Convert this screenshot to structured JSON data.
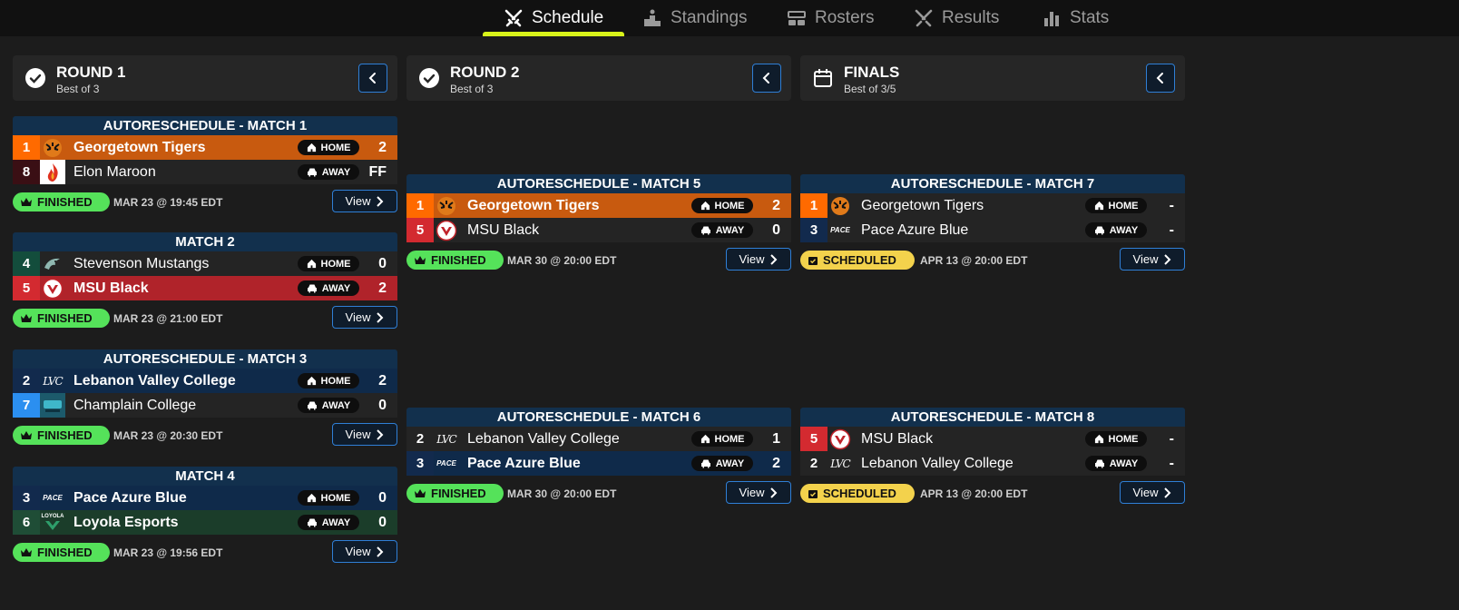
{
  "nav": {
    "tabs": [
      {
        "label": "Schedule",
        "icon": "crossed-swords-icon",
        "active": true
      },
      {
        "label": "Standings",
        "icon": "podium-icon",
        "active": false
      },
      {
        "label": "Rosters",
        "icon": "roster-icon",
        "active": false
      },
      {
        "label": "Results",
        "icon": "crossed-swords-icon",
        "active": false
      },
      {
        "label": "Stats",
        "icon": "bar-chart-icon",
        "active": false
      }
    ]
  },
  "rounds": [
    {
      "title": "ROUND 1",
      "subtitle": "Best of 3",
      "icon": "check-circle-icon"
    },
    {
      "title": "ROUND 2",
      "subtitle": "Best of 3",
      "icon": "check-circle-icon"
    },
    {
      "title": "FINALS",
      "subtitle": "Best of 3/5",
      "icon": "calendar-icon"
    }
  ],
  "labels": {
    "home": "HOME",
    "away": "AWAY",
    "view": "View",
    "finished": "FINISHED",
    "scheduled": "SCHEDULED"
  },
  "matches": {
    "m1": {
      "title": "AUTORESCHEDULE - MATCH 1",
      "home": {
        "seed": "1",
        "name": "Georgetown Tigers",
        "score": "2"
      },
      "away": {
        "seed": "8",
        "name": "Elon Maroon",
        "score": "FF"
      },
      "status": "FINISHED",
      "date": "MAR 23 @ 19:45 EDT"
    },
    "m2": {
      "title": "MATCH 2",
      "home": {
        "seed": "4",
        "name": "Stevenson Mustangs",
        "score": "0"
      },
      "away": {
        "seed": "5",
        "name": "MSU Black",
        "score": "2"
      },
      "status": "FINISHED",
      "date": "MAR 23 @ 21:00 EDT"
    },
    "m3": {
      "title": "AUTORESCHEDULE - MATCH 3",
      "home": {
        "seed": "2",
        "name": "Lebanon Valley College",
        "score": "2"
      },
      "away": {
        "seed": "7",
        "name": "Champlain College",
        "score": "0"
      },
      "status": "FINISHED",
      "date": "MAR 23 @ 20:30 EDT"
    },
    "m4": {
      "title": "MATCH 4",
      "home": {
        "seed": "3",
        "name": "Pace Azure Blue",
        "score": "0"
      },
      "away": {
        "seed": "6",
        "name": "Loyola Esports",
        "score": "0"
      },
      "status": "FINISHED",
      "date": "MAR 23 @ 19:56 EDT"
    },
    "m5": {
      "title": "AUTORESCHEDULE - MATCH 5",
      "home": {
        "seed": "1",
        "name": "Georgetown Tigers",
        "score": "2"
      },
      "away": {
        "seed": "5",
        "name": "MSU Black",
        "score": "0"
      },
      "status": "FINISHED",
      "date": "MAR 30 @ 20:00 EDT"
    },
    "m6": {
      "title": "AUTORESCHEDULE - MATCH 6",
      "home": {
        "seed": "2",
        "name": "Lebanon Valley College",
        "score": "1"
      },
      "away": {
        "seed": "3",
        "name": "Pace Azure Blue",
        "score": "2"
      },
      "status": "FINISHED",
      "date": "MAR 30 @ 20:00 EDT"
    },
    "m7": {
      "title": "AUTORESCHEDULE - MATCH 7",
      "home": {
        "seed": "1",
        "name": "Georgetown Tigers",
        "score": "-"
      },
      "away": {
        "seed": "3",
        "name": "Pace Azure Blue",
        "score": "-"
      },
      "status": "SCHEDULED",
      "date": "APR 13 @ 20:00 EDT"
    },
    "m8": {
      "title": "AUTORESCHEDULE - MATCH 8",
      "home": {
        "seed": "5",
        "name": "MSU Black",
        "score": "-"
      },
      "away": {
        "seed": "2",
        "name": "Lebanon Valley College",
        "score": "-"
      },
      "status": "SCHEDULED",
      "date": "APR 13 @ 20:00 EDT"
    }
  },
  "logo_text": {
    "lvc": "LVC",
    "pace": "PACE",
    "loyola": "LOYOLA"
  },
  "colors": {
    "accent": "#d8f31a",
    "finished": "#55e25a",
    "scheduled": "#f3d24c",
    "button_border": "#2f7fd6"
  }
}
